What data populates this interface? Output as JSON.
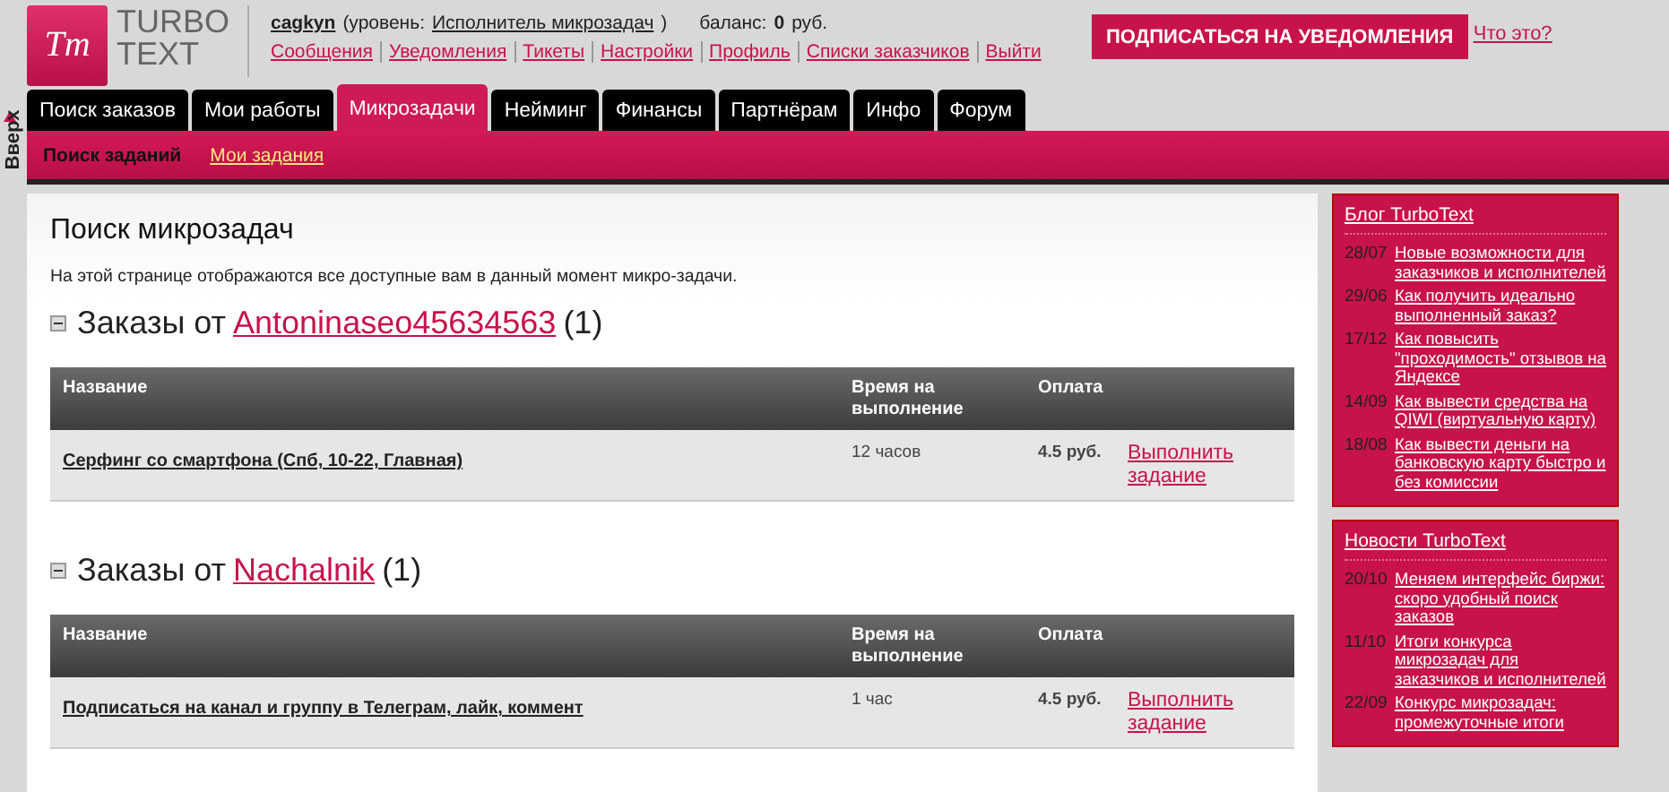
{
  "logo": {
    "mark": "Tт",
    "word_top": "TURBO",
    "word_bottom": "TEXT"
  },
  "user": {
    "name": "cagkyn",
    "level_prefix": "(уровень:",
    "level": "Исполнитель микрозадач",
    "level_suffix": ")",
    "balance_label": "баланс:",
    "balance": "0",
    "currency": "руб."
  },
  "nav_links": [
    "Сообщения",
    "Уведомления",
    "Тикеты",
    "Настройки",
    "Профиль",
    "Списки заказчиков",
    "Выйти"
  ],
  "subscribe_button": "ПОДПИСАТЬСЯ НА УВЕДОМЛЕНИЯ",
  "what_link": "Что это?",
  "up_link": "Вверх",
  "tabs": [
    {
      "label": "Поиск заказов",
      "selected": false
    },
    {
      "label": "Мои работы",
      "selected": false
    },
    {
      "label": "Микрозадачи",
      "selected": true
    },
    {
      "label": "Нейминг",
      "selected": false
    },
    {
      "label": "Финансы",
      "selected": false
    },
    {
      "label": "Партнёрам",
      "selected": false
    },
    {
      "label": "Инфо",
      "selected": false
    },
    {
      "label": "Форум",
      "selected": false
    }
  ],
  "subtabs": [
    {
      "label": "Поиск заданий",
      "selected": true
    },
    {
      "label": "Мои задания",
      "selected": false
    }
  ],
  "page_title": "Поиск микрозадач",
  "description": "На этой странице отображаются все доступные вам в данный момент микро-задачи.",
  "groups": [
    {
      "prefix": "Заказы от",
      "customer": "Antoninaseo45634563",
      "count": "(1)",
      "expanded": true,
      "columns": [
        "Название",
        "Время на выполнение",
        "Оплата"
      ],
      "rows": [
        {
          "title": "Серфинг со смартфона (Спб, 10-22, Главная)",
          "time": "12 часов",
          "pay": "4.5 руб.",
          "action": "Выполнить задание"
        }
      ]
    },
    {
      "prefix": "Заказы от",
      "customer": "Nachalnik",
      "count": "(1)",
      "expanded": true,
      "columns": [
        "Название",
        "Время на выполнение",
        "Оплата"
      ],
      "rows": [
        {
          "title": "Подписаться на канал и группу в Телеграм, лайк, коммент",
          "time": "1 час",
          "pay": "4.5 руб.",
          "action": "Выполнить задание"
        }
      ]
    }
  ],
  "sidebar": [
    {
      "title": "Блог TurboText",
      "items": [
        {
          "date": "28/07",
          "text": "Новые возможности для заказчиков и исполнителей"
        },
        {
          "date": "29/06",
          "text": "Как получить идеально выполненный заказ?"
        },
        {
          "date": "17/12",
          "text": "Как повысить \"проходимость\" отзывов на Яндексе"
        },
        {
          "date": "14/09",
          "text": "Как вывести средства на QIWI (виртуальную карту)"
        },
        {
          "date": "18/08",
          "text": "Как вывести деньги на банковскую карту быстро и без комиссии"
        }
      ]
    },
    {
      "title": "Новости TurboText",
      "items": [
        {
          "date": "20/10",
          "text": "Меняем интерфейс биржи: скоро удобный поиск заказов"
        },
        {
          "date": "11/10",
          "text": "Итоги конкурса микрозадач для заказчиков и исполнителей"
        },
        {
          "date": "22/09",
          "text": "Конкурс микрозадач: промежуточные итоги"
        }
      ]
    }
  ]
}
